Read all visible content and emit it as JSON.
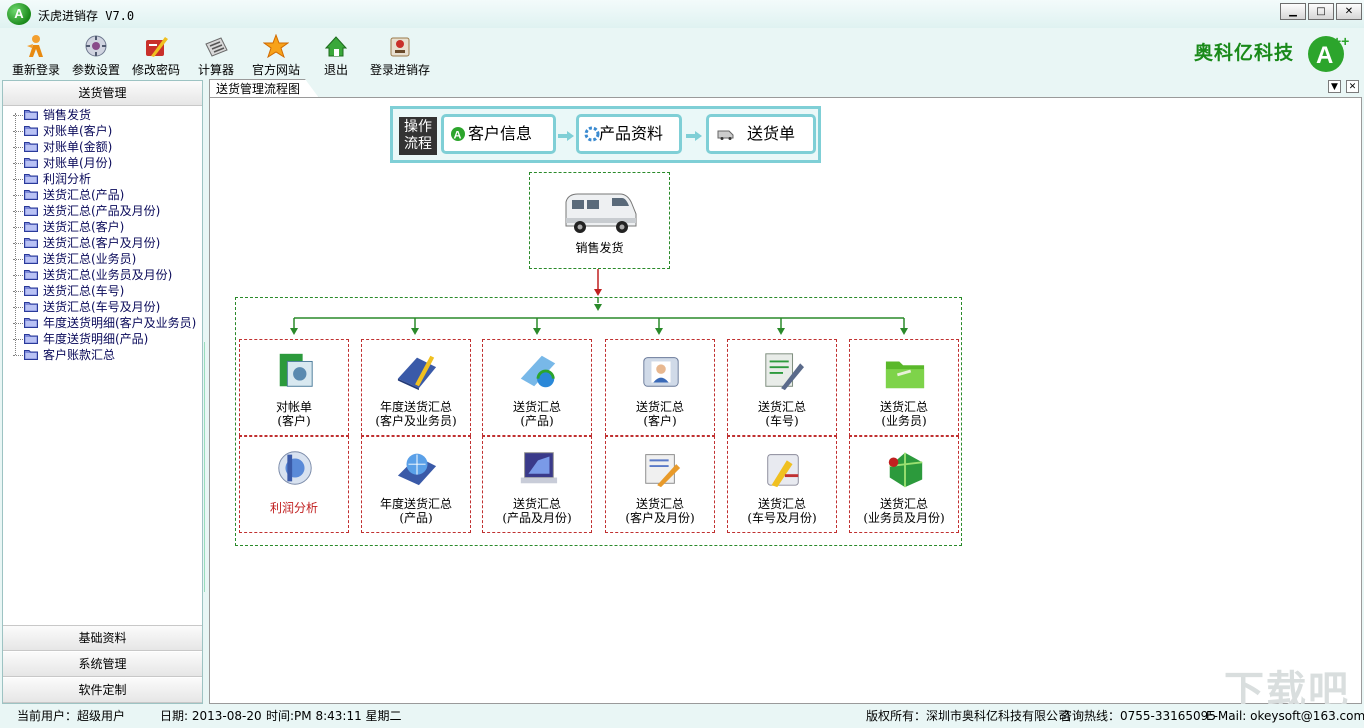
{
  "window": {
    "title": "沃虎进销存 V7.0",
    "controls": [
      "▁",
      "□",
      "✕"
    ]
  },
  "brand": {
    "name": "奥科亿科技"
  },
  "toolbar": [
    {
      "label": "重新登录",
      "icon": "relogin-icon"
    },
    {
      "label": "参数设置",
      "icon": "settings-icon"
    },
    {
      "label": "修改密码",
      "icon": "change-password-icon"
    },
    {
      "label": "计算器",
      "icon": "calculator-icon"
    },
    {
      "label": "官方网站",
      "icon": "star-icon"
    },
    {
      "label": "退出",
      "icon": "exit-icon"
    },
    {
      "label": "登录进销存",
      "icon": "login-inventory-icon"
    }
  ],
  "sidebar": {
    "active_section": "送货管理",
    "items": [
      "销售发货",
      "对账单(客户)",
      "对账单(金额)",
      "对账单(月份)",
      "利润分析",
      "送货汇总(产品)",
      "送货汇总(产品及月份)",
      "送货汇总(客户)",
      "送货汇总(客户及月份)",
      "送货汇总(业务员)",
      "送货汇总(业务员及月份)",
      "送货汇总(车号)",
      "送货汇总(车号及月份)",
      "年度送货明细(客户及业务员)",
      "年度送货明细(产品)",
      "客户账款汇总"
    ],
    "sections": [
      "基础资料",
      "系统管理",
      "软件定制"
    ]
  },
  "tab": {
    "title": "送货管理流程图"
  },
  "flow": {
    "caption_line1": "操作",
    "caption_line2": "流程",
    "steps": [
      "客户信息",
      "产品资料",
      "送货单"
    ]
  },
  "diagram": {
    "root": "销售发货",
    "cells": [
      {
        "line1": "对帐单",
        "line2": "(客户)",
        "color": "#000000"
      },
      {
        "line1": "年度送货汇总",
        "line2": "(客户及业务员)",
        "color": "#000000"
      },
      {
        "line1": "送货汇总",
        "line2": "(产品)",
        "color": "#000000"
      },
      {
        "line1": "送货汇总",
        "line2": "(客户)",
        "color": "#000000"
      },
      {
        "line1": "送货汇总",
        "line2": "(车号)",
        "color": "#000000"
      },
      {
        "line1": "送货汇总",
        "line2": "(业务员)",
        "color": "#000000"
      },
      {
        "line1": "利润分析",
        "line2": "",
        "color": "#c02020"
      },
      {
        "line1": "年度送货汇总",
        "line2": "(产品)",
        "color": "#000000"
      },
      {
        "line1": "送货汇总",
        "line2": "(产品及月份)",
        "color": "#000000"
      },
      {
        "line1": "送货汇总",
        "line2": "(客户及月份)",
        "color": "#000000"
      },
      {
        "line1": "送货汇总",
        "line2": "(车号及月份)",
        "color": "#000000"
      },
      {
        "line1": "送货汇总",
        "line2": "(业务员及月份)",
        "color": "#000000"
      }
    ]
  },
  "status": {
    "user": "当前用户：超级用户",
    "date": "日期: 2013-08-20",
    "time": "时间:PM 8:43:11 星期二",
    "copyright": "版权所有：深圳市奥科亿科技有限公司",
    "hotline": "咨询热线：0755-33165095",
    "email": "E-Mail: okeysoft@163.com"
  },
  "colors": {
    "accent": "#7fcfd6",
    "brand_green": "#1a8a1a",
    "window_bg": "#e9f6f5"
  }
}
